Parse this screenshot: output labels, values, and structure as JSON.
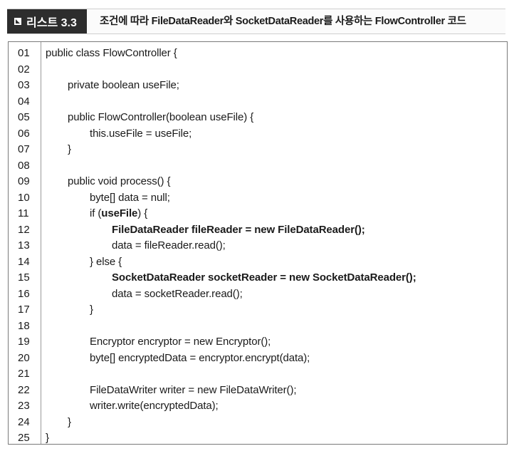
{
  "header": {
    "label": "리스트 3.3",
    "caption": "조건에 따라 FileDataReader와 SocketDataReader를 사용하는 FlowController 코드"
  },
  "lines": [
    {
      "n": "01",
      "indent": 0,
      "parts": [
        {
          "t": "public class FlowController {",
          "b": false
        }
      ]
    },
    {
      "n": "02",
      "indent": 0,
      "parts": []
    },
    {
      "n": "03",
      "indent": 1,
      "parts": [
        {
          "t": "private boolean useFile;",
          "b": false
        }
      ]
    },
    {
      "n": "04",
      "indent": 0,
      "parts": []
    },
    {
      "n": "05",
      "indent": 1,
      "parts": [
        {
          "t": "public FlowController(boolean useFile) {",
          "b": false
        }
      ]
    },
    {
      "n": "06",
      "indent": 2,
      "parts": [
        {
          "t": "this.useFile = useFile;",
          "b": false
        }
      ]
    },
    {
      "n": "07",
      "indent": 1,
      "parts": [
        {
          "t": "}",
          "b": false
        }
      ]
    },
    {
      "n": "08",
      "indent": 0,
      "parts": []
    },
    {
      "n": "09",
      "indent": 1,
      "parts": [
        {
          "t": "public void process() {",
          "b": false
        }
      ]
    },
    {
      "n": "10",
      "indent": 2,
      "parts": [
        {
          "t": "byte[] data = null;",
          "b": false
        }
      ]
    },
    {
      "n": "11",
      "indent": 2,
      "parts": [
        {
          "t": "if (",
          "b": false
        },
        {
          "t": "useFile",
          "b": true
        },
        {
          "t": ") {",
          "b": false
        }
      ]
    },
    {
      "n": "12",
      "indent": 3,
      "parts": [
        {
          "t": "FileDataReader fileReader = new FileDataReader();",
          "b": true
        }
      ]
    },
    {
      "n": "13",
      "indent": 3,
      "parts": [
        {
          "t": "data = fileReader.read();",
          "b": false
        }
      ]
    },
    {
      "n": "14",
      "indent": 2,
      "parts": [
        {
          "t": "} else {",
          "b": false
        }
      ]
    },
    {
      "n": "15",
      "indent": 3,
      "parts": [
        {
          "t": "SocketDataReader socketReader = new SocketDataReader();",
          "b": true
        }
      ]
    },
    {
      "n": "16",
      "indent": 3,
      "parts": [
        {
          "t": "data = socketReader.read();",
          "b": false
        }
      ]
    },
    {
      "n": "17",
      "indent": 2,
      "parts": [
        {
          "t": "}",
          "b": false
        }
      ]
    },
    {
      "n": "18",
      "indent": 0,
      "parts": []
    },
    {
      "n": "19",
      "indent": 2,
      "parts": [
        {
          "t": "Encryptor encryptor = new Encryptor();",
          "b": false
        }
      ]
    },
    {
      "n": "20",
      "indent": 2,
      "parts": [
        {
          "t": "byte[] encryptedData = encryptor.encrypt(data);",
          "b": false
        }
      ]
    },
    {
      "n": "21",
      "indent": 0,
      "parts": []
    },
    {
      "n": "22",
      "indent": 2,
      "parts": [
        {
          "t": "FileDataWriter writer = new FileDataWriter();",
          "b": false
        }
      ]
    },
    {
      "n": "23",
      "indent": 2,
      "parts": [
        {
          "t": "writer.write(encryptedData);",
          "b": false
        }
      ]
    },
    {
      "n": "24",
      "indent": 1,
      "parts": [
        {
          "t": "}",
          "b": false
        }
      ]
    },
    {
      "n": "25",
      "indent": 0,
      "parts": [
        {
          "t": "}",
          "b": false
        }
      ]
    }
  ]
}
